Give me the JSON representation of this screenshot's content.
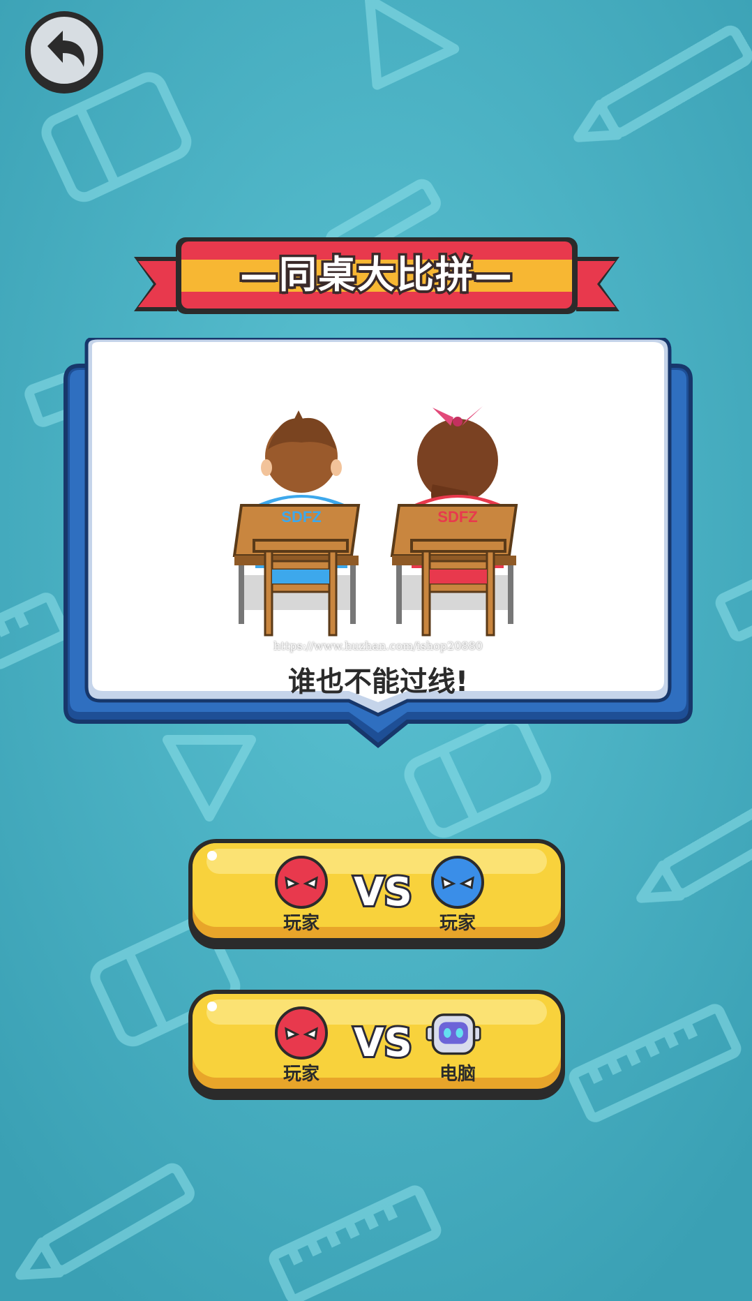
{
  "screen": {
    "background_color": "#4ab3c5",
    "back_button_icon": "undo-arrow-icon"
  },
  "banner": {
    "title": "—同桌大比拼—",
    "colors": {
      "red": "#e8394d",
      "yellow": "#f7b733",
      "outline": "#3a2a2a"
    }
  },
  "illustration": {
    "caption": "谁也不能过线!",
    "shirt_text_left": "SDFZ",
    "shirt_text_right": "SDFZ",
    "watermark": "https://www.huzhan.com/ishop20880",
    "book_color": "#2f6fc0"
  },
  "modes": [
    {
      "left_label": "玩家",
      "left_icon": "red-angry-face-icon",
      "vs_text": "VS",
      "right_label": "玩家",
      "right_icon": "blue-angry-face-icon"
    },
    {
      "left_label": "玩家",
      "left_icon": "red-angry-face-icon",
      "vs_text": "VS",
      "right_label": "电脑",
      "right_icon": "robot-icon"
    }
  ],
  "button_color": "#f8d23c"
}
